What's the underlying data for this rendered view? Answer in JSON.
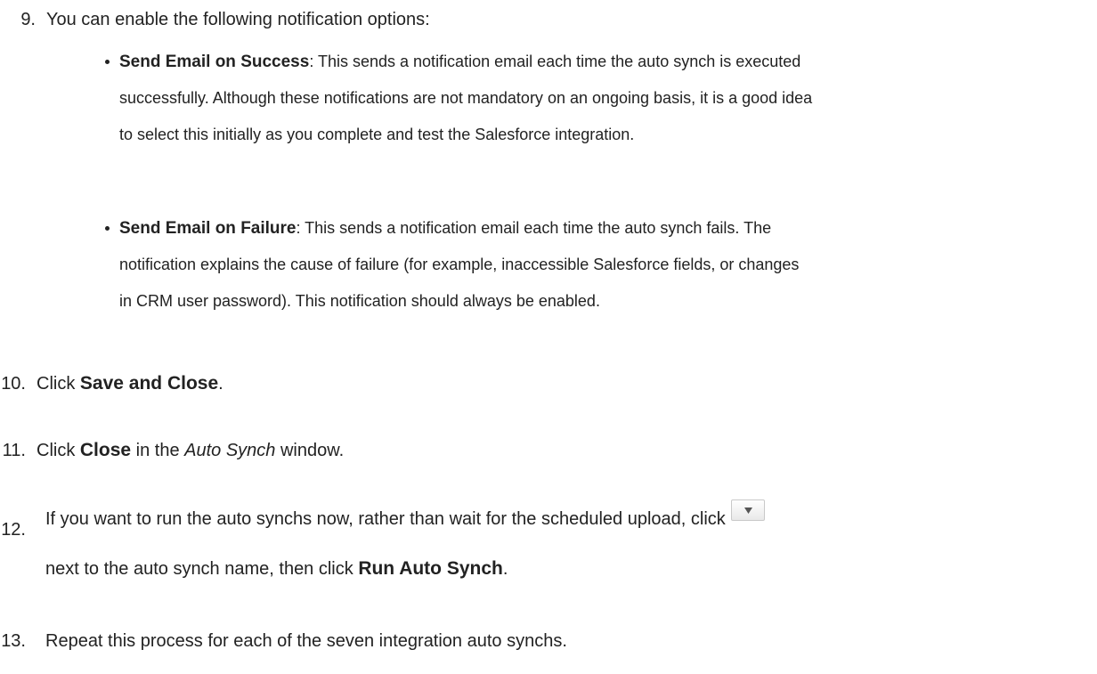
{
  "steps": [
    {
      "number": "9.",
      "text": "You can enable the following notification options:"
    },
    {
      "number": "10.",
      "prefix": "Click ",
      "strong": "Save and Close",
      "suffix": "."
    },
    {
      "number": "11.",
      "prefix": "Click ",
      "strong": "Close",
      "middle": " in the ",
      "em": "Auto Synch",
      "suffix": " window."
    },
    {
      "number": "12.",
      "line1": "If you want to run the auto synchs now, rather than wait for the scheduled upload, click",
      "line2_prefix": "next to the auto synch name, then click ",
      "strong": "Run Auto Synch",
      "suffix": "."
    },
    {
      "number": "13.",
      "text": "Repeat this process for each of the seven integration auto synchs."
    }
  ],
  "bullets": [
    {
      "title": "Send Email on Success",
      "line1": ": This sends a notification email each time the auto synch is executed",
      "line2": "successfully. Although these notifications are not mandatory on an ongoing basis, it is a good idea",
      "line3": "to select this initially as you complete and test the Salesforce integration."
    },
    {
      "title": "Send Email on Failure",
      "line1": ": This sends a notification email each time the auto synch fails. The",
      "line2": "notification explains the cause of failure (for example, inaccessible Salesforce fields, or changes",
      "line3": "in CRM user password). This notification should always be enabled."
    }
  ],
  "icons": {
    "dropdown": "chevron-down-icon"
  }
}
